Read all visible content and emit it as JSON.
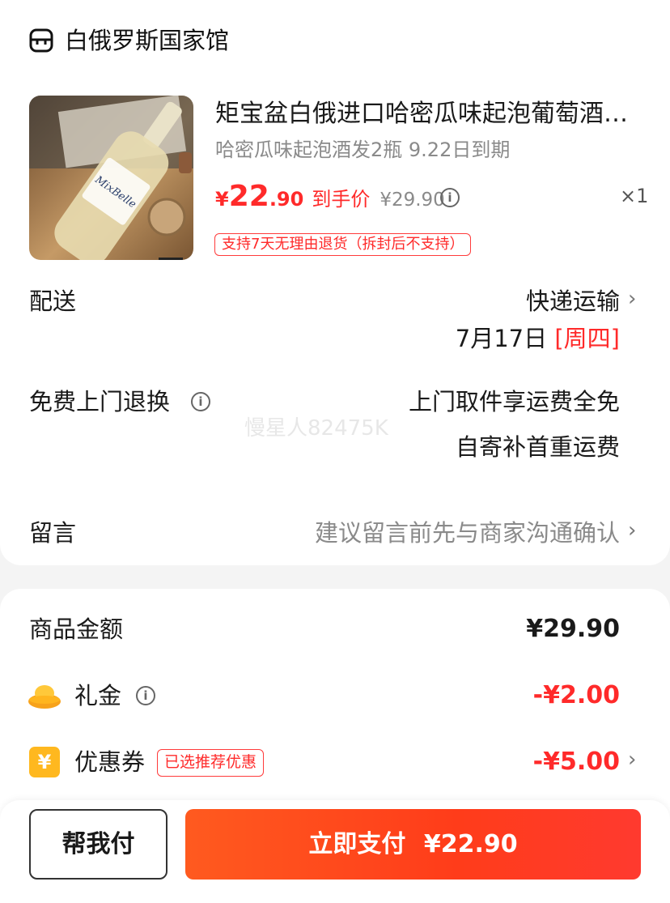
{
  "store": {
    "icon": "store-icon",
    "name": "白俄罗斯国家馆"
  },
  "product": {
    "image_label": "MixBelle",
    "title": "矩宝盆白俄进口哈密瓜味起泡葡萄酒…",
    "sku": "哈密瓜味起泡酒发2瓶 9.22日到期",
    "price_symbol": "¥",
    "price_int": "22",
    "price_dec": ".90",
    "price_tag": "到手价",
    "original_price": "¥29.90",
    "quantity": "×1",
    "return_policy": "支持7天无理由退货（拆封后不支持）"
  },
  "delivery": {
    "label": "配送",
    "method": "快递运输",
    "date": "7月17日",
    "weekday": "[周四]"
  },
  "free_return": {
    "label": "免费上门退换",
    "line1": "上门取件享运费全免",
    "line2": "自寄补首重运费"
  },
  "watermark": "慢星人82475K",
  "message": {
    "label": "留言",
    "placeholder": "建议留言前先与商家沟通确认"
  },
  "summary": {
    "goods_label": "商品金额",
    "goods_amount": "¥29.90",
    "gift_label": "礼金",
    "gift_amount": "-¥2.00",
    "coupon_icon_text": "¥",
    "coupon_label": "优惠券",
    "coupon_badge": "已选推荐优惠",
    "coupon_amount": "-¥5.00"
  },
  "footer": {
    "help_pay": "帮我付",
    "pay_label": "立即支付",
    "pay_amount": "¥22.90"
  },
  "colors": {
    "accent_red": "#ff2a2a",
    "pay_button": "#ff4a1f",
    "coupon_yellow": "#ffb81f"
  }
}
